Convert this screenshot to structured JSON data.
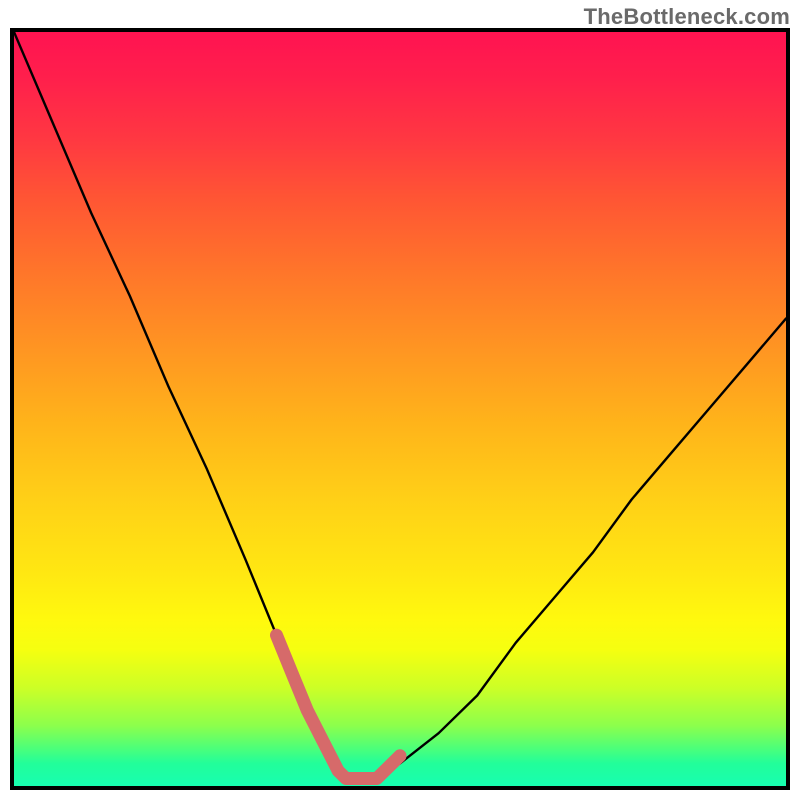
{
  "attribution": "TheBottleneck.com",
  "chart_data": {
    "type": "line",
    "title": "",
    "xlabel": "",
    "ylabel": "",
    "xlim": [
      0,
      100
    ],
    "ylim": [
      0,
      100
    ],
    "series": [
      {
        "name": "bottleneck-curve",
        "x": [
          0,
          5,
          10,
          15,
          20,
          25,
          30,
          34,
          37,
          40,
          42,
          44,
          47,
          50,
          55,
          60,
          65,
          70,
          75,
          80,
          85,
          90,
          95,
          100
        ],
        "values": [
          100,
          88,
          76,
          65,
          53,
          42,
          30,
          20,
          12,
          6,
          2,
          1,
          1,
          3,
          7,
          12,
          19,
          25,
          31,
          38,
          44,
          50,
          56,
          62
        ]
      },
      {
        "name": "optimal-band-marker",
        "x": [
          34,
          36,
          38,
          40,
          41,
          42,
          43,
          44,
          45,
          46,
          47,
          48,
          50
        ],
        "values": [
          20,
          15,
          10,
          6,
          4,
          2,
          1,
          1,
          1,
          1,
          1,
          2,
          4
        ]
      }
    ],
    "gradient_colors": {
      "top": "#ff1351",
      "mid": "#ffe812",
      "bottom": "#17feb0"
    }
  }
}
